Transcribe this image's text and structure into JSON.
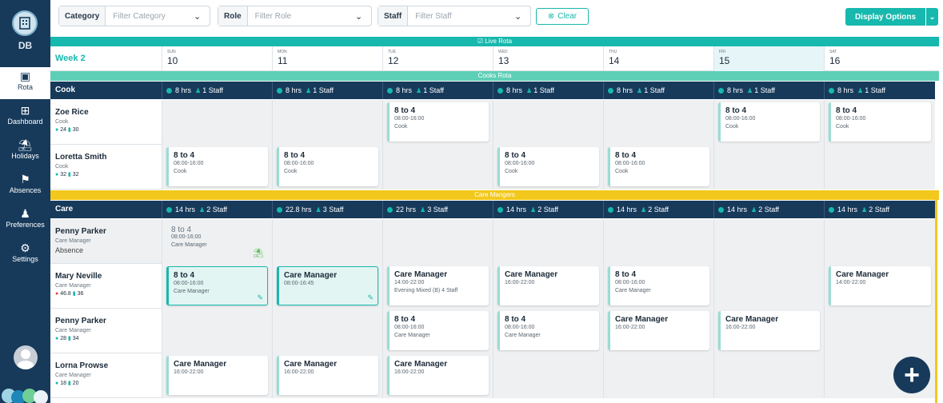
{
  "sidebar": {
    "initials": "DB",
    "items": [
      {
        "label": "Rota",
        "icon": "calendar-icon",
        "active": true
      },
      {
        "label": "Dashboard",
        "icon": "grid-icon",
        "active": false
      },
      {
        "label": "Holidays",
        "icon": "beach-icon",
        "active": false
      },
      {
        "label": "Absences",
        "icon": "absence-icon",
        "active": false
      },
      {
        "label": "Preferences",
        "icon": "user-cog-icon",
        "active": false
      },
      {
        "label": "Settings",
        "icon": "gear-icon",
        "active": false
      }
    ]
  },
  "filters": {
    "category": {
      "label": "Category",
      "placeholder": "Filter Category"
    },
    "role": {
      "label": "Role",
      "placeholder": "Filter Role"
    },
    "staff": {
      "label": "Staff",
      "placeholder": "Filter Staff"
    },
    "clear_label": "Clear",
    "display_label": "Display Options"
  },
  "rota": {
    "live_label": "Live Rota",
    "week_label": "Week 2",
    "days": [
      {
        "name": "SUN",
        "date": "10"
      },
      {
        "name": "MON",
        "date": "11"
      },
      {
        "name": "TUE",
        "date": "12"
      },
      {
        "name": "WED",
        "date": "13"
      },
      {
        "name": "THU",
        "date": "14"
      },
      {
        "name": "FRI",
        "date": "15"
      },
      {
        "name": "SAT",
        "date": "16"
      }
    ],
    "selected_day": 5
  },
  "groups": [
    {
      "title": "Cooks Rota",
      "role": "Cook",
      "color": "#5ecfb7",
      "summary": [
        {
          "hrs": "8 hrs",
          "staff": "1 Staff"
        },
        {
          "hrs": "8 hrs",
          "staff": "1 Staff"
        },
        {
          "hrs": "8 hrs",
          "staff": "1 Staff"
        },
        {
          "hrs": "8 hrs",
          "staff": "1 Staff"
        },
        {
          "hrs": "8 hrs",
          "staff": "1 Staff"
        },
        {
          "hrs": "8 hrs",
          "staff": "1 Staff"
        },
        {
          "hrs": "8 hrs",
          "staff": "1 Staff"
        }
      ],
      "staff": [
        {
          "name": "Zoe Rice",
          "role": "Cook",
          "stat1": "24",
          "stat2": "30",
          "grey": false,
          "shifts": [
            null,
            null,
            {
              "title": "8 to 4",
              "time": "08:00-16:00",
              "role": "Cook"
            },
            null,
            null,
            {
              "title": "8 to 4",
              "time": "08:00-16:00",
              "role": "Cook"
            },
            {
              "title": "8 to 4",
              "time": "08:00-16:00",
              "role": "Cook"
            }
          ]
        },
        {
          "name": "Loretta Smith",
          "role": "Cook",
          "stat1": "32",
          "stat2": "32",
          "grey": false,
          "shifts": [
            {
              "title": "8 to 4",
              "time": "08:00-16:00",
              "role": "Cook"
            },
            {
              "title": "8 to 4",
              "time": "08:00-16:00",
              "role": "Cook"
            },
            null,
            {
              "title": "8 to 4",
              "time": "08:00-16:00",
              "role": "Cook"
            },
            {
              "title": "8 to 4",
              "time": "08:00-16:00",
              "role": "Cook"
            },
            null,
            null
          ]
        }
      ]
    },
    {
      "title": "Care Mangers",
      "role": "Care",
      "color": "#f2c81c",
      "summary": [
        {
          "hrs": "14 hrs",
          "staff": "2 Staff"
        },
        {
          "hrs": "22.8 hrs",
          "staff": "3 Staff"
        },
        {
          "hrs": "22 hrs",
          "staff": "3 Staff"
        },
        {
          "hrs": "14 hrs",
          "staff": "2 Staff"
        },
        {
          "hrs": "14 hrs",
          "staff": "2 Staff"
        },
        {
          "hrs": "14 hrs",
          "staff": "2 Staff"
        },
        {
          "hrs": "14 hrs",
          "staff": "2 Staff"
        }
      ],
      "staff": [
        {
          "name": "Penny Parker",
          "role": "Care Manager",
          "absence": "Absence",
          "grey": true,
          "shifts": [
            {
              "title": "8 to 4",
              "time": "08:00-16:00",
              "role": "Care Manager",
              "absent": true
            },
            null,
            null,
            null,
            null,
            null,
            null
          ]
        },
        {
          "name": "Mary Neville",
          "role": "Care Manager",
          "stat1": "46.8",
          "stat2": "36",
          "warn": true,
          "grey": false,
          "shifts": [
            {
              "title": "8 to 4",
              "time": "08:00-16:00",
              "role": "Care Manager",
              "hl": true
            },
            {
              "title": "Care Manager",
              "time": "08:00-16:45",
              "role": "",
              "hl": true
            },
            {
              "title": "Care Manager",
              "time": "14:00-22:00",
              "role": "Evening Mixed (B) 4 Staff"
            },
            {
              "title": "Care Manager",
              "time": "16:00-22:00",
              "role": ""
            },
            {
              "title": "8 to 4",
              "time": "08:00-16:00",
              "role": "Care Manager"
            },
            null,
            {
              "title": "Care Manager",
              "time": "14:00-22:00",
              "role": ""
            }
          ]
        },
        {
          "name": "Penny Parker",
          "role": "Care Manager",
          "stat1": "28",
          "stat2": "34",
          "grey": false,
          "shifts": [
            null,
            null,
            {
              "title": "8 to 4",
              "time": "08:00-16:00",
              "role": "Care Manager"
            },
            {
              "title": "8 to 4",
              "time": "08:00-16:00",
              "role": "Care Manager"
            },
            {
              "title": "Care Manager",
              "time": "16:00-22:00",
              "role": ""
            },
            {
              "title": "Care Manager",
              "time": "16:00-22:00",
              "role": ""
            },
            null
          ]
        },
        {
          "name": "Lorna Prowse",
          "role": "Care Manager",
          "stat1": "18",
          "stat2": "20",
          "grey": false,
          "shifts": [
            {
              "title": "Care Manager",
              "time": "16:00-22:00",
              "role": ""
            },
            {
              "title": "Care Manager",
              "time": "16:00-22:00",
              "role": ""
            },
            {
              "title": "Care Manager",
              "time": "16:00-22:00",
              "role": ""
            },
            null,
            null,
            null,
            null
          ]
        }
      ]
    }
  ],
  "fab_label": "+"
}
